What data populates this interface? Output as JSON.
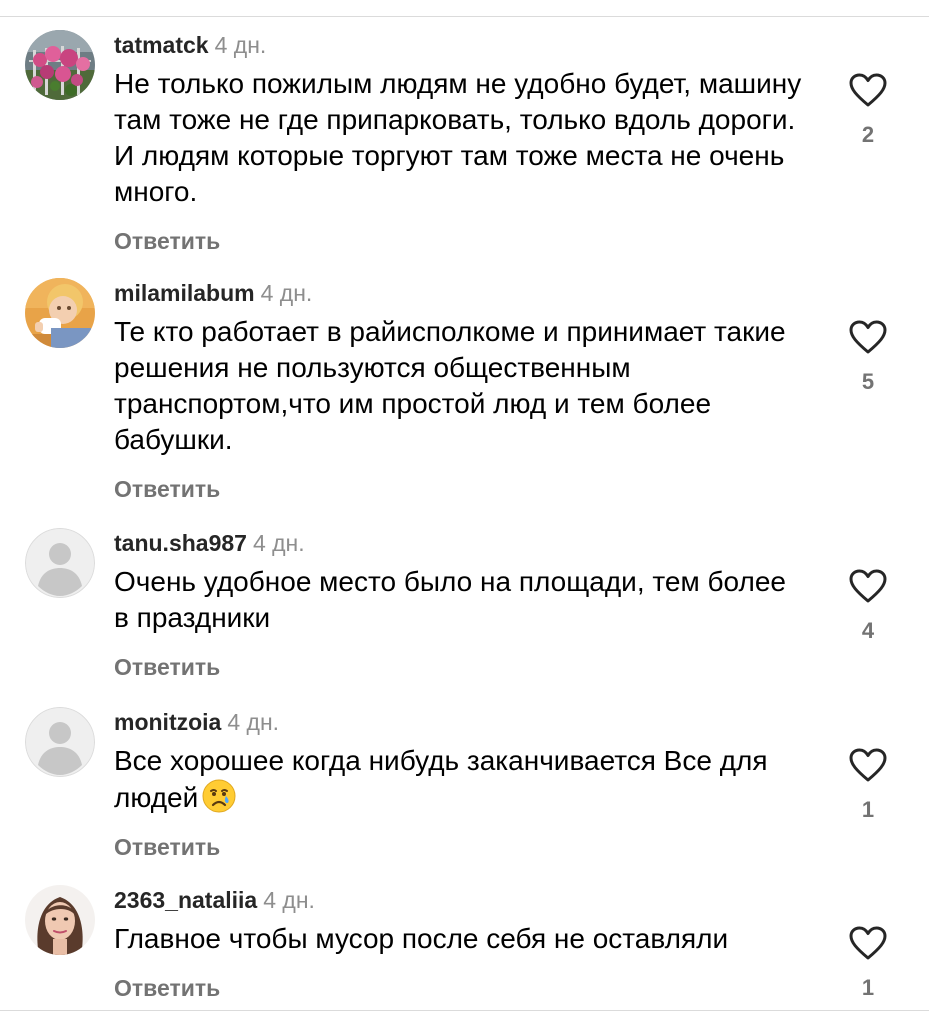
{
  "colors": {
    "username": "#262626",
    "timestamp": "#8e8e8e",
    "reply": "#737373",
    "like_count": "#737373",
    "divider": "#dbdbdb"
  },
  "comments": [
    {
      "username": "tatmatck",
      "time": "4 дн.",
      "text": "Не только пожилым людям не удобно будет, машину там тоже не где припарковать, только вдоль дороги. И людям которые торгуют там тоже места не очень много.",
      "reply_label": "Ответить",
      "likes": "2",
      "avatar": "flowers-photo"
    },
    {
      "username": "milamilabum",
      "time": "4 дн.",
      "text": "Те кто работает в райисполкоме и принимает такие решения не пользуются общественным транспортом,что им простой люд и тем более бабушки.",
      "reply_label": "Ответить",
      "likes": "5",
      "avatar": "child-photo"
    },
    {
      "username": "tanu.sha987",
      "time": "4 дн.",
      "text": "Очень удобное место было на площади, тем более в праздники",
      "reply_label": "Ответить",
      "likes": "4",
      "avatar": "default-user-icon"
    },
    {
      "username": "monitzoia",
      "time": "4 дн.",
      "text": "Все хорошее когда нибудь заканчивается Все для людей",
      "emoji": "crying-face-emoji",
      "reply_label": "Ответить",
      "likes": "1",
      "avatar": "default-user-icon"
    },
    {
      "username": "2363_nataliia",
      "time": "4 дн.",
      "text": "Главное чтобы мусор после себя не оставляли",
      "reply_label": "Ответить",
      "likes": "1",
      "avatar": "woman-photo"
    }
  ]
}
